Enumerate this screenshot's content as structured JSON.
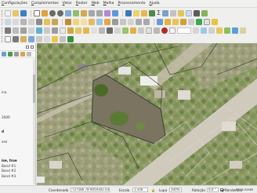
{
  "menubar": {
    "items": [
      {
        "label": "Configurações",
        "u": "C",
        "rest": "onfigurações"
      },
      {
        "label": "Complementos",
        "u": "C",
        "rest": "omplementos"
      },
      {
        "label": "Vetor",
        "u": "V",
        "rest": "etor"
      },
      {
        "label": "Raster",
        "u": "R",
        "rest": "aster"
      },
      {
        "label": "Web",
        "u": "W",
        "rest": "eb"
      },
      {
        "label": "Malha",
        "u": "M",
        "rest": "alha"
      },
      {
        "label": "Processamento",
        "u": "P",
        "rest": "rocessamento"
      },
      {
        "label": "Ajuda",
        "u": "A",
        "rest": "juda"
      }
    ]
  },
  "toolbar": {
    "sigma_glyph": "Σ",
    "spin_value": "0"
  },
  "layers_panel": {
    "partial_labels": [
      {
        "text": "ina",
        "bold": false
      },
      {
        "text": "2000",
        "bold": false
      },
      {
        "text": "d",
        "bold": true
      },
      {
        "text": "ose",
        "bold": false
      },
      {
        "text": "ise, true",
        "bold": true
      },
      {
        "text": "Band #1",
        "bold": false
      },
      {
        "text": "Band #2",
        "bold": false
      },
      {
        "text": "Band #3",
        "bold": false
      }
    ]
  },
  "statusbar": {
    "coord_label": "Coordenada",
    "coord_value": "727586.78 9059301.03",
    "scale_label": "Escala",
    "scale_value": "1:356",
    "magnifier_label": "Lupa",
    "magnifier_value": "100%",
    "rotation_label": "Rotação",
    "rotation_value": "0,0 °",
    "render_label": "Renderizar",
    "render_checked": true,
    "epsg_label": "EPSG:31985"
  },
  "colors": {
    "road": "#cfcabb",
    "vegetation": "#5b7a34",
    "parcel_line": "#2f2f2f",
    "parcel_line_light": "#d8d8d8"
  }
}
